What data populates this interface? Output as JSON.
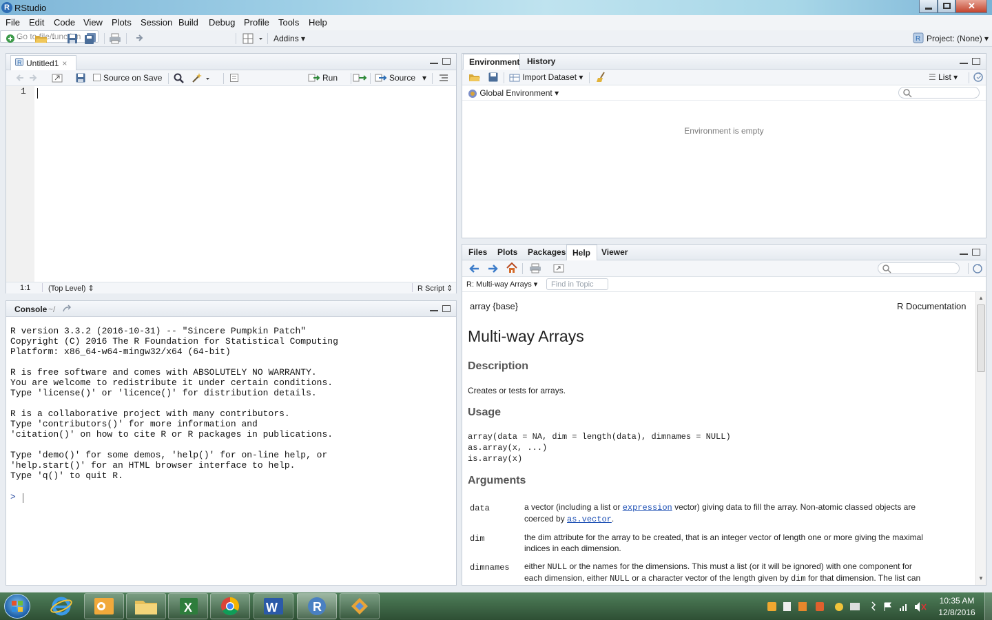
{
  "window": {
    "title": "RStudio",
    "logo_letter": "R"
  },
  "menu": [
    "File",
    "Edit",
    "Code",
    "View",
    "Plots",
    "Session",
    "Build",
    "Debug",
    "Profile",
    "Tools",
    "Help"
  ],
  "toolbar": {
    "goto_placeholder": "Go to file/function",
    "addins": "Addins",
    "project": "Project: (None)"
  },
  "editor": {
    "tab": "Untitled1",
    "source_on_save": "Source on Save",
    "run": "Run",
    "source": "Source",
    "line_number": "1",
    "status_pos": "1:1",
    "status_scope": "(Top Level)",
    "status_type": "R Script"
  },
  "console": {
    "title": "Console",
    "path": "~/",
    "lines": [
      "R version 3.3.2 (2016-10-31) -- \"Sincere Pumpkin Patch\"",
      "Copyright (C) 2016 The R Foundation for Statistical Computing",
      "Platform: x86_64-w64-mingw32/x64 (64-bit)",
      "",
      "R is free software and comes with ABSOLUTELY NO WARRANTY.",
      "You are welcome to redistribute it under certain conditions.",
      "Type 'license()' or 'licence()' for distribution details.",
      "",
      "R is a collaborative project with many contributors.",
      "Type 'contributors()' for more information and",
      "'citation()' on how to cite R or R packages in publications.",
      "",
      "Type 'demo()' for some demos, 'help()' for on-line help, or",
      "'help.start()' for an HTML browser interface to help.",
      "Type 'q()' to quit R."
    ],
    "prompt": ">"
  },
  "environment": {
    "tabs": [
      "Environment",
      "History"
    ],
    "import_dataset": "Import Dataset",
    "list_view": "List",
    "scope": "Global Environment",
    "empty_message": "Environment is empty"
  },
  "files_pane": {
    "tabs": [
      "Files",
      "Plots",
      "Packages",
      "Help",
      "Viewer"
    ],
    "topic": "R: Multi-way Arrays",
    "find_placeholder": "Find in Topic"
  },
  "help_doc": {
    "pkg": "array {base}",
    "rdoc": "R Documentation",
    "title": "Multi-way Arrays",
    "h_description": "Description",
    "description": "Creates or tests for arrays.",
    "h_usage": "Usage",
    "usage": [
      "array(data = NA, dim = length(data), dimnames = NULL)",
      "as.array(x, ...)",
      "is.array(x)"
    ],
    "h_arguments": "Arguments",
    "arg_data_name": "data",
    "arg_data_pre": "a vector (including a list or ",
    "arg_data_link1": "expression",
    "arg_data_mid": " vector) giving data to fill the array. Non-atomic classed objects are",
    "arg_data_pre2": "coerced by ",
    "arg_data_link2": "as.vector",
    "arg_data_post2": ".",
    "arg_dim_name": "dim",
    "arg_dim_1": "the dim attribute for the array to be created, that is an integer vector of length one or more giving the maximal",
    "arg_dim_2": "indices in each dimension.",
    "arg_dimnames_name": "dimnames",
    "arg_dimnames_1a": "either ",
    "arg_dimnames_1b": "NULL",
    "arg_dimnames_1c": " or the names for the dimensions. This must a list (or it will be ignored) with one component for",
    "arg_dimnames_2a": "each dimension, either ",
    "arg_dimnames_2b": "NULL",
    "arg_dimnames_2c": " or a character vector of the length given by ",
    "arg_dimnames_2d": "dim",
    "arg_dimnames_2e": " for that dimension. The list can"
  },
  "taskbar": {
    "time": "10:35 AM",
    "date": "12/8/2016"
  },
  "colors": {
    "accent": "#2d6db5",
    "link": "#1a4db3"
  }
}
